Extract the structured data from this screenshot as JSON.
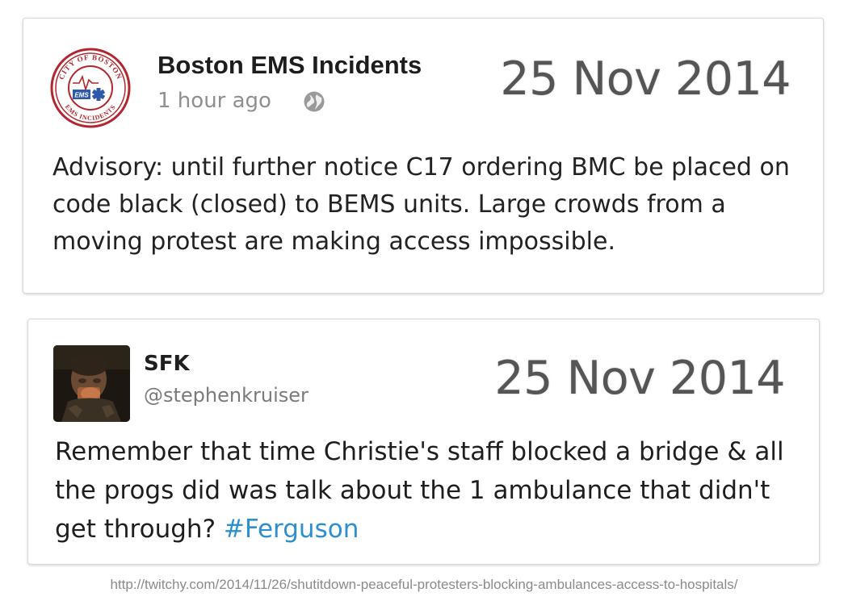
{
  "facebook_post": {
    "author": "Boston EMS Incidents",
    "time": "1 hour ago",
    "date_overlay": "25 Nov 2014",
    "body": "Advisory: until further notice C17 ordering BMC be placed on code black (closed) to BEMS units. Large crowds from a moving protest are making access impossible.",
    "avatar": {
      "icon": "boston-ems-seal",
      "top_text": "CITY OF BOSTON",
      "bottom_text": "EMS INCIDENTS",
      "center_text": "EMS"
    },
    "privacy_icon": "globe-icon"
  },
  "twitter_post": {
    "name": "SFK",
    "handle": "@stephenkruiser",
    "date_overlay": "25 Nov 2014",
    "body": "Remember that time Christie's staff blocked a bridge & all the progs did was talk about the 1 ambulance that didn't get through? ",
    "hashtag": "#Ferguson",
    "avatar_icon": "profile-photo"
  },
  "source_url": "http://twitchy.com/2014/11/26/shutitdown-peaceful-protesters-blocking-ambulances-access-to-hospitals/",
  "colors": {
    "seal_red": "#b3262d",
    "seal_blue": "#2d5aa8",
    "hashtag_blue": "#2b8fd0",
    "date_gray": "#555555"
  }
}
